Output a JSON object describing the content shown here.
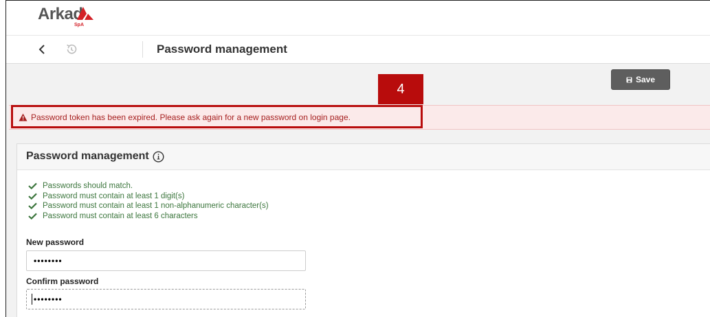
{
  "header": {
    "brand": "Arkad",
    "brand_suffix": "SpA",
    "page_title": "Password management"
  },
  "toolbar": {
    "save_label": "Save"
  },
  "alert": {
    "message": "Password token has been expired. Please ask again for a new password on login page."
  },
  "annotation": {
    "step_number": "4",
    "color": "#b80c0c"
  },
  "panel": {
    "title": "Password management",
    "rules": [
      "Passwords should match.",
      "Password must contain at least 1 digit(s)",
      "Password must contain at least 1 non-alphanumeric character(s)",
      "Password must contain at least 6 characters"
    ],
    "new_password": {
      "label": "New password",
      "value": "••••••••"
    },
    "confirm_password": {
      "label": "Confirm password",
      "value": "••••••••"
    }
  },
  "colors": {
    "brand_red": "#d32027",
    "success_green": "#3c763d",
    "error_text": "#a62020",
    "error_bg": "#fbeaea",
    "save_button_bg": "#5e5e5e"
  }
}
